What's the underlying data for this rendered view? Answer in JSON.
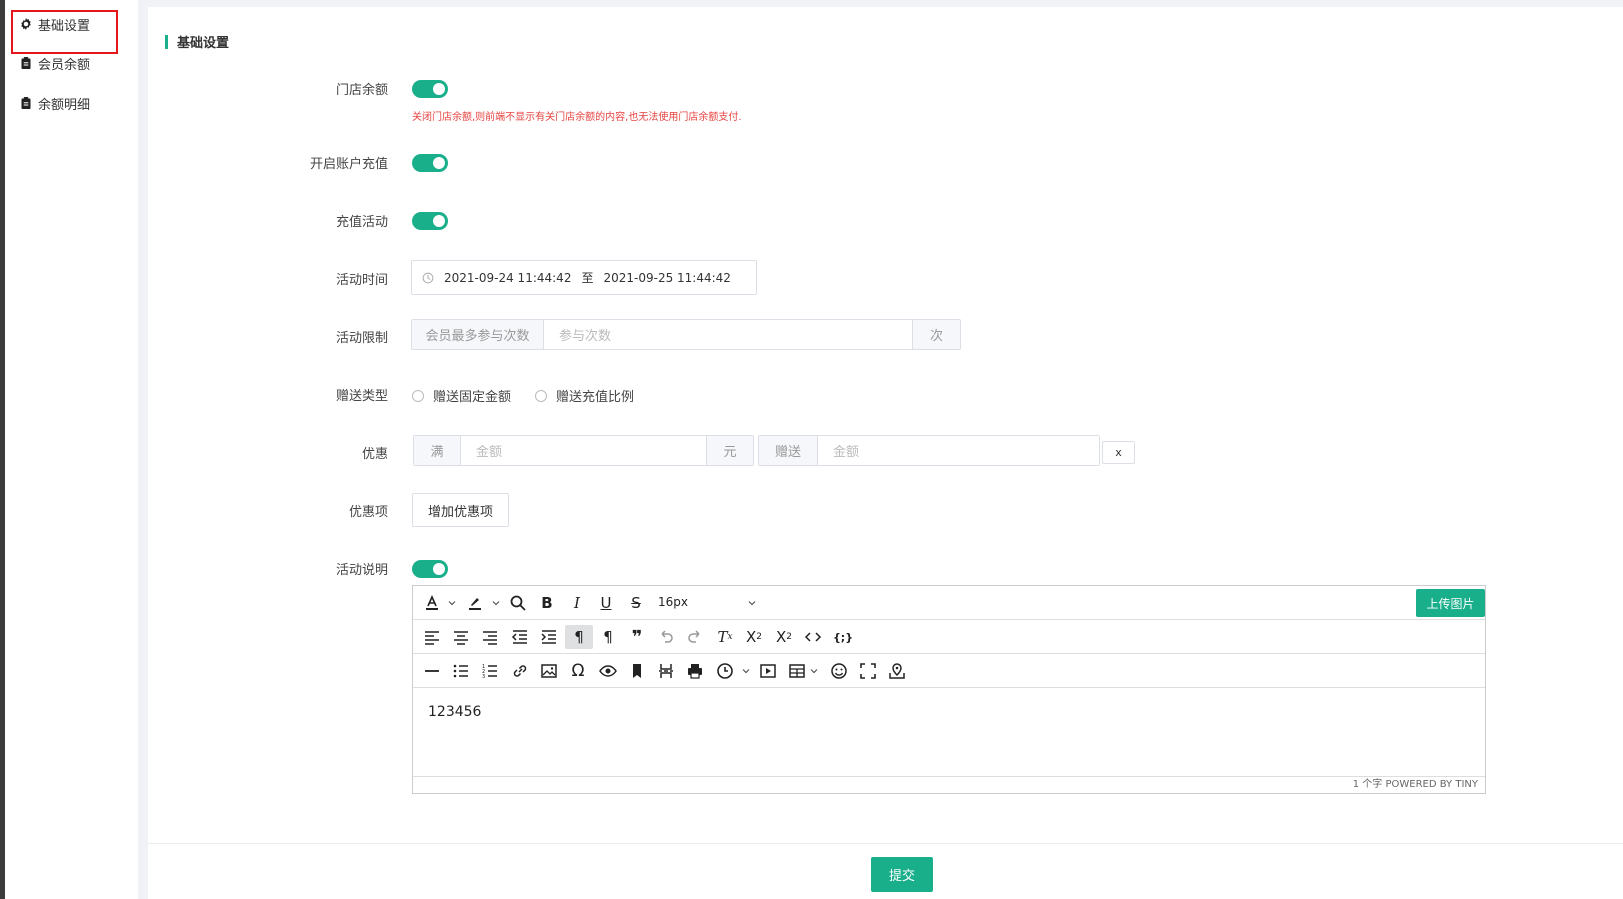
{
  "sidebar": {
    "items": [
      {
        "label": "基础设置",
        "icon": "gear-icon"
      },
      {
        "label": "会员余额",
        "icon": "clipboard-icon"
      },
      {
        "label": "余额明细",
        "icon": "clipboard-icon"
      }
    ]
  },
  "section_title": "基础设置",
  "form": {
    "store_balance": {
      "label": "门店余额",
      "enabled": true,
      "hint": "关闭门店余额,则前端不显示有关门店余额的内容,也无法使用门店余额支付."
    },
    "account_recharge": {
      "label": "开启账户充值",
      "enabled": true
    },
    "recharge_activity": {
      "label": "充值活动",
      "enabled": true
    },
    "activity_time": {
      "label": "活动时间",
      "start": "2021-09-24 11:44:42",
      "separator": "至",
      "end": "2021-09-25 11:44:42"
    },
    "activity_limit": {
      "label": "活动限制",
      "prefix": "会员最多参与次数",
      "placeholder": "参与次数",
      "suffix": "次"
    },
    "gift_type": {
      "label": "赠送类型",
      "options": [
        "赠送固定金额",
        "赠送充值比例"
      ]
    },
    "discount": {
      "label": "优惠",
      "prefix": "满",
      "amount_placeholder": "金额",
      "unit": "元",
      "gift_prefix": "赠送",
      "gift_placeholder": "金额",
      "remove": "x"
    },
    "discount_items": {
      "label": "优惠项",
      "add_button": "增加优惠项"
    },
    "activity_desc": {
      "label": "活动说明",
      "enabled": true
    }
  },
  "editor": {
    "font_size": "16px",
    "upload_label": "上传图片",
    "content": "123456",
    "status": "1 个字  POWERED BY TINY"
  },
  "submit_label": "提交",
  "colors": {
    "accent": "#1aaf8b",
    "hint": "#e64340",
    "highlight": "#e5161b"
  }
}
